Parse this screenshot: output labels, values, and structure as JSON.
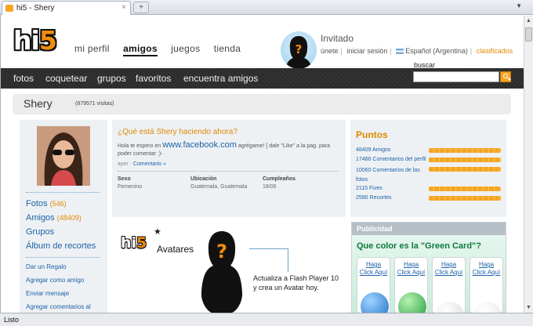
{
  "browser": {
    "tab_title": "hi5 - Shery",
    "tab_close": "×",
    "new_tab": "+",
    "tab_menu": "▼",
    "status": "Listo"
  },
  "header": {
    "logo_hi": "hi",
    "logo_five": "5",
    "nav": [
      "mi perfil",
      "amigos",
      "juegos",
      "tienda"
    ],
    "user_name": "Invitado",
    "links": [
      "únete",
      "iniciar sesión",
      "Español (Argentina)",
      "clasificados"
    ]
  },
  "navbar": {
    "items": [
      "fotos",
      "coquetear",
      "grupos",
      "favoritos",
      "encuentra amigos"
    ],
    "search_label": "buscar",
    "search_value": ""
  },
  "profile": {
    "name": "Shery",
    "visits": "(879571 visitas)"
  },
  "left": {
    "big_links": [
      {
        "label": "Fotos",
        "count": "(546)"
      },
      {
        "label": "Amigos",
        "count": "(48409)"
      },
      {
        "label": "Grupos",
        "count": ""
      },
      {
        "label": "Álbum de recortes",
        "count": ""
      }
    ],
    "small_links": [
      "Dar un Regalo",
      "Agregar como amigo",
      "Enviar mensaje",
      "Agregar comentarios al"
    ]
  },
  "status": {
    "question": "¿Qué está Shery haciendo ahora?",
    "text_pre": "Hola te espero en ",
    "text_fb": "www.facebook.com",
    "text_post": " agrégame! [ dale \"Like\" a la pag. para poder comentar :)-",
    "meta_time": "ayer",
    "meta_sep": " · ",
    "meta_comment": "Comentario »",
    "info": [
      {
        "label": "Sexo",
        "value": "Femenino"
      },
      {
        "label": "Ubicación",
        "value": "Guatemala, Guatemala"
      },
      {
        "label": "Cumpleaños",
        "value": "18/06"
      }
    ]
  },
  "puntos": {
    "title": "Puntos",
    "rows": [
      "48409 Amigos",
      "17486 Comentarios del perfil",
      "10060 Comentarios de las fotos",
      "2115 Fives",
      "2580 Recortes"
    ]
  },
  "avatars": {
    "logo_hi": "hi",
    "logo_five": "5",
    "star": "★",
    "title": "Avatares",
    "message_line1": "Actualiza a Flash Player 10",
    "message_line2": "y crea un Avatar hoy."
  },
  "publicidad": {
    "header": "Publicidad",
    "ad_title": "Que color es la \"Green Card\"?",
    "cards": [
      {
        "line1": "Haga",
        "line2": "Click Aquí",
        "color": "#2a8fe0"
      },
      {
        "line1": "Haga",
        "line2": "Click Aquí",
        "color": "#2aa84a"
      },
      {
        "line1": "Haga",
        "line2": "Click Aquí",
        "color": "#e0e0e0"
      },
      {
        "line1": "Haga",
        "line2": "Click Aquí",
        "color": "#ffffff"
      }
    ]
  },
  "colors": {
    "accent": "#e08a00",
    "link": "#1d62a7"
  }
}
